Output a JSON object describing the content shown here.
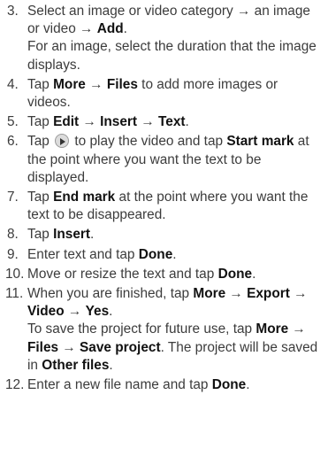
{
  "steps": [
    {
      "num": "3.",
      "parts": [
        {
          "t": "Select an image or video category → an image or video → "
        },
        {
          "t": "Add",
          "b": true
        },
        {
          "t": "."
        }
      ],
      "sub": [
        [
          {
            "t": "For an image, select the duration that the image displays."
          }
        ]
      ]
    },
    {
      "num": "4.",
      "parts": [
        {
          "t": "Tap "
        },
        {
          "t": "More",
          "b": true
        },
        {
          "t": " → "
        },
        {
          "t": "Files",
          "b": true
        },
        {
          "t": " to add more images or videos."
        }
      ]
    },
    {
      "num": "5.",
      "parts": [
        {
          "t": "Tap "
        },
        {
          "t": "Edit",
          "b": true
        },
        {
          "t": " → "
        },
        {
          "t": "Insert",
          "b": true
        },
        {
          "t": " → "
        },
        {
          "t": "Text",
          "b": true
        },
        {
          "t": "."
        }
      ]
    },
    {
      "num": "6.",
      "parts": [
        {
          "t": "Tap "
        },
        {
          "icon": "play-icon"
        },
        {
          "t": " to play the video and tap "
        },
        {
          "t": "Start mark",
          "b": true
        },
        {
          "t": " at the point where you want the text to be displayed."
        }
      ]
    },
    {
      "num": "7.",
      "parts": [
        {
          "t": "Tap "
        },
        {
          "t": "End mark",
          "b": true
        },
        {
          "t": " at the point where you want the text to be disappeared."
        }
      ]
    },
    {
      "num": "8.",
      "parts": [
        {
          "t": "Tap "
        },
        {
          "t": "Insert",
          "b": true
        },
        {
          "t": "."
        }
      ]
    },
    {
      "num": "9.",
      "parts": [
        {
          "t": "Enter text and tap "
        },
        {
          "t": "Done",
          "b": true
        },
        {
          "t": "."
        }
      ]
    },
    {
      "num": "10.",
      "parts": [
        {
          "t": "Move or resize the text and tap "
        },
        {
          "t": "Done",
          "b": true
        },
        {
          "t": "."
        }
      ]
    },
    {
      "num": "11.",
      "parts": [
        {
          "t": "When you are finished, tap "
        },
        {
          "t": "More",
          "b": true
        },
        {
          "t": " → "
        },
        {
          "t": "Export",
          "b": true
        },
        {
          "t": " → "
        },
        {
          "t": "Video",
          "b": true
        },
        {
          "t": " → "
        },
        {
          "t": "Yes",
          "b": true
        },
        {
          "t": "."
        }
      ],
      "sub": [
        [
          {
            "t": "To save the project for future use, tap "
          },
          {
            "t": "More",
            "b": true
          },
          {
            "t": " → "
          },
          {
            "t": "Files",
            "b": true
          },
          {
            "t": " → "
          },
          {
            "t": "Save project",
            "b": true
          },
          {
            "t": ". The project will be saved in "
          },
          {
            "t": "Other files",
            "b": true
          },
          {
            "t": "."
          }
        ]
      ]
    },
    {
      "num": "12.",
      "parts": [
        {
          "t": "Enter a new file name and tap "
        },
        {
          "t": "Done",
          "b": true
        },
        {
          "t": "."
        }
      ]
    }
  ]
}
